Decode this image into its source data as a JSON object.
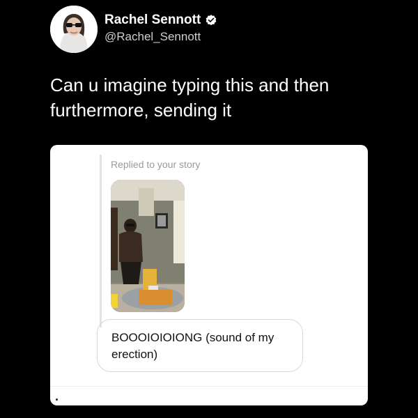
{
  "author": {
    "display_name": "Rachel Sennott",
    "handle": "@Rachel_Sennott",
    "avatar_icon": "profile-photo",
    "verified_icon": "verified-badge-icon"
  },
  "tweet": {
    "text": "Can u imagine typing this and then furthermore, sending it"
  },
  "media": {
    "reply_label": "Replied to your story",
    "story_image": "story-thumbnail",
    "message": "BOOOIOIOIONG (sound of my erection)"
  },
  "colors": {
    "background": "#000000",
    "text": "#ffffff",
    "handle": "#cfcfcf",
    "card": "#ffffff"
  }
}
